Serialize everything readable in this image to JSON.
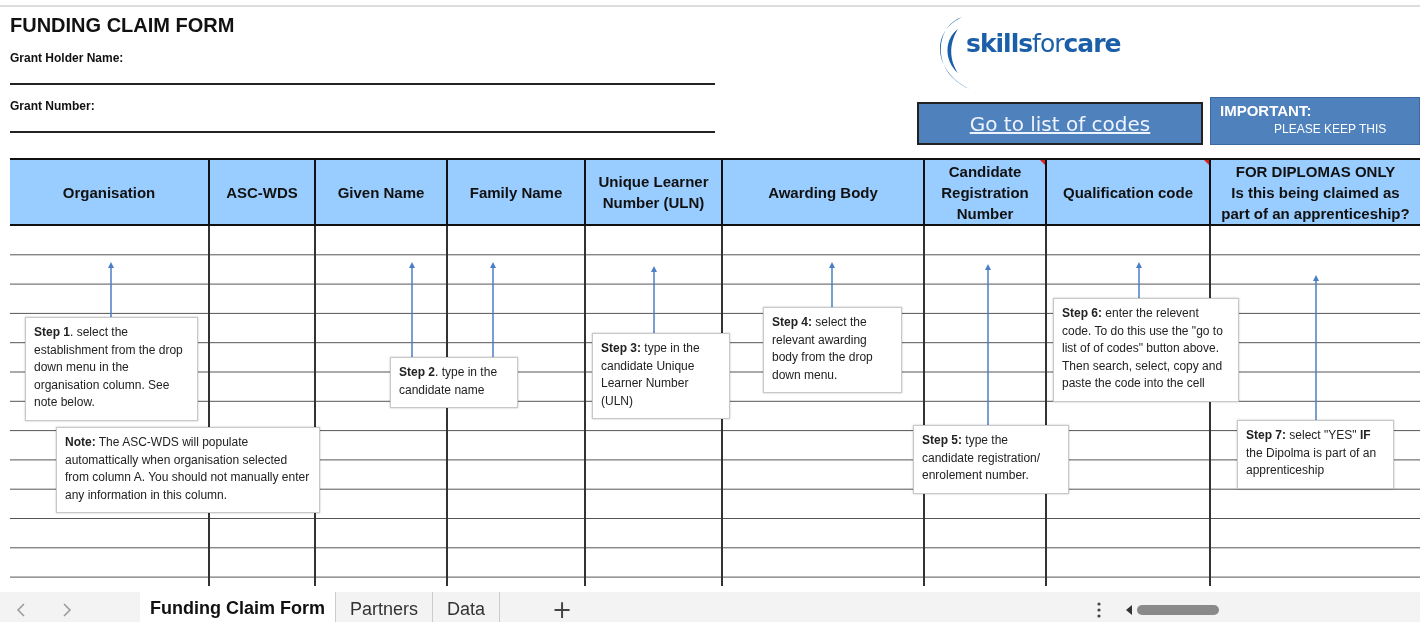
{
  "title": "FUNDING CLAIM FORM",
  "fields": [
    {
      "label": "Grant Holder Name:"
    },
    {
      "label": "Grant Number:"
    }
  ],
  "logo": {
    "parts": [
      {
        "text": "skills",
        "light": false
      },
      {
        "text": "for",
        "light": true
      },
      {
        "text": "care",
        "light": false
      }
    ]
  },
  "codes_button": "Go to list of codes",
  "important": {
    "heading": "IMPORTANT:",
    "text": "PLEASE KEEP THIS"
  },
  "columns": [
    {
      "label": "Organisation",
      "has_comment": false
    },
    {
      "label": "ASC-WDS",
      "has_comment": false
    },
    {
      "label": "Given Name",
      "has_comment": false
    },
    {
      "label": "Family Name",
      "has_comment": false
    },
    {
      "label": "Unique Learner\nNumber (ULN)",
      "has_comment": false
    },
    {
      "label": "Awarding Body",
      "has_comment": false
    },
    {
      "label": "Candidate\nRegistration\nNumber",
      "has_comment": true
    },
    {
      "label": "Qualification code",
      "has_comment": true
    },
    {
      "label": "FOR DIPLOMAS ONLY\nIs this being claimed as\npart of an apprenticeship?",
      "has_comment": false
    }
  ],
  "callouts": [
    {
      "text": "**Step 1**. select the establishment from the drop down menu in the organisation column. See note below."
    },
    {
      "text": "**Note:** The ASC-WDS will populate automattically when organisation selected from column A. You should not manually enter any information in this column."
    },
    {
      "text": "**Step 2**. type in the candidate name"
    },
    {
      "text": "**Step 3:** type in the candidate Unique Learner Number (ULN)"
    },
    {
      "text": "**Step 4:** select the relevant awarding body  from the drop down menu."
    },
    {
      "text": "**Step 5:** type the candidate registration/ enrolement number."
    },
    {
      "text": "**Step 6:** enter the relevent code. To do this use the \"go to list of of codes\" button above. Then search, select, copy and paste the code into the cell"
    },
    {
      "text": "**Step 7:** select \"YES\" **IF** the Dipolma is part of an apprenticeship"
    }
  ],
  "sheet_tabs": [
    {
      "label": "Funding Claim Form",
      "selected": true
    },
    {
      "label": "Partners",
      "selected": false
    },
    {
      "label": "Data",
      "selected": false
    }
  ],
  "add_sheet": "+"
}
